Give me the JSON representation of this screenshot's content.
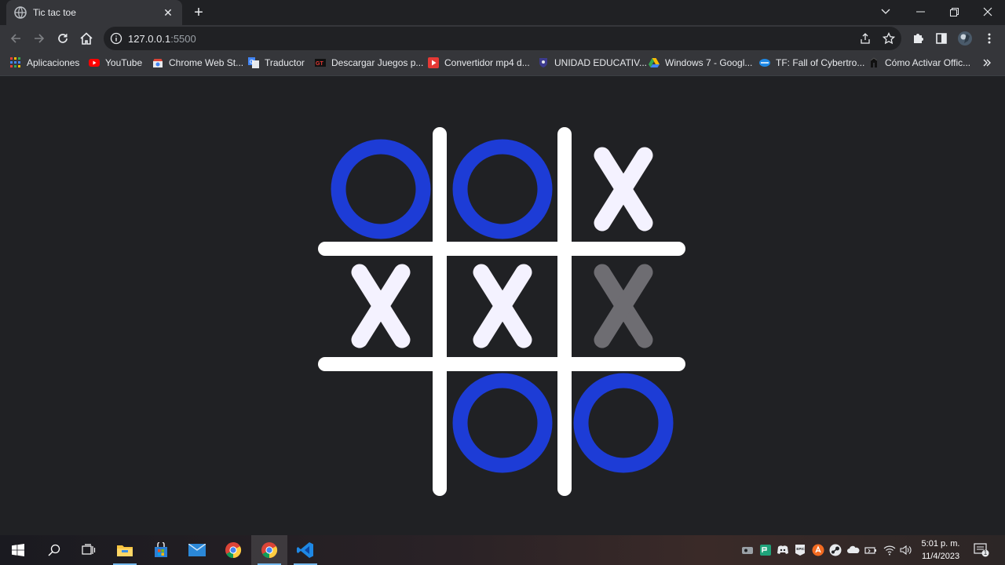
{
  "browser": {
    "tab_title": "Tic tac toe",
    "url_host": "127.0.0.1",
    "url_port": ":5500"
  },
  "bookmarks": [
    {
      "label": "Aplicaciones",
      "icon": "apps-grid-icon"
    },
    {
      "label": "YouTube",
      "icon": "youtube-icon"
    },
    {
      "label": "Chrome Web St...",
      "icon": "chrome-web-store-icon"
    },
    {
      "label": "Traductor",
      "icon": "translate-icon"
    },
    {
      "label": "Descargar Juegos p...",
      "icon": "gt-icon"
    },
    {
      "label": "Convertidor mp4 d...",
      "icon": "play-icon"
    },
    {
      "label": "UNIDAD EDUCATIV...",
      "icon": "school-crest-icon"
    },
    {
      "label": "Windows 7 - Googl...",
      "icon": "google-drive-icon"
    },
    {
      "label": "TF: Fall of Cybertro...",
      "icon": "transformers-icon"
    },
    {
      "label": "Cómo Activar Offic...",
      "icon": "office-icon"
    }
  ],
  "game": {
    "cells": [
      "O",
      "O",
      "X",
      "X",
      "X",
      "X",
      "",
      "O",
      "O"
    ],
    "dimmed_cells": [
      5
    ],
    "colors": {
      "o": "#1d3cd6",
      "x": "#f4f2ff",
      "x_dim": "#6e6d72",
      "grid": "#ffffff"
    }
  },
  "taskbar": {
    "apps": [
      "windows-start-icon",
      "search-icon",
      "task-view-icon",
      "file-explorer-icon",
      "microsoft-store-icon",
      "mail-icon",
      "chrome-icon",
      "chrome-icon",
      "vscode-icon"
    ],
    "clock_time": "5:01 p. m.",
    "clock_date": "11/4/2023",
    "notification_count": "1"
  }
}
